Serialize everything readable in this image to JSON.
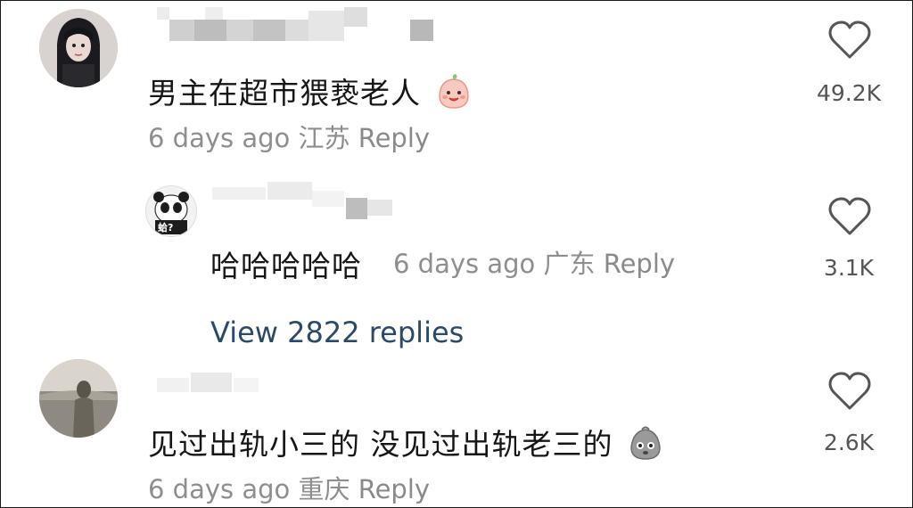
{
  "comments": [
    {
      "text": "男主在超市猥亵老人",
      "time": "6 days ago",
      "location": "江苏",
      "reply_label": "Reply",
      "likes": "49.2K"
    },
    {
      "text": "哈哈哈哈哈",
      "time": "6 days ago",
      "location": "广东",
      "reply_label": "Reply",
      "likes": "3.1K",
      "avatar_caption": "蛤?"
    },
    {
      "text": "见过出轨小三的 没见过出轨老三的",
      "time": "6 days ago",
      "location": "重庆",
      "reply_label": "Reply",
      "likes": "2.6K"
    }
  ],
  "view_replies": "View 2822 replies",
  "colors": {
    "link": "#2c4a67",
    "meta": "#8e8e8e",
    "text": "#161616"
  },
  "icons": [
    "heart-outline-icon",
    "peach-emoji-icon",
    "bag-emoji-icon"
  ]
}
